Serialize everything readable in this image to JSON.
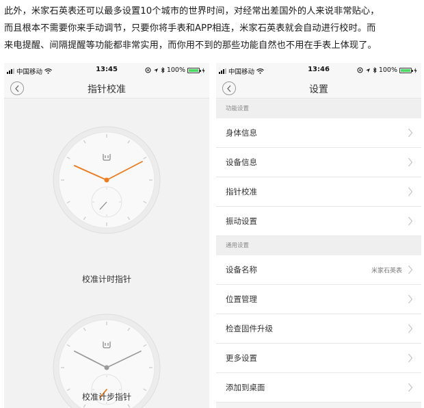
{
  "article": {
    "lines": [
      "此外，米家石英表还可以最多设置10个城市的世界时间，对经常出差国外的人来说非常贴心，",
      "而且根本不需要你来手动调节，只要你将手表和APP相连，米家石英表就会自动进行校时。而",
      "来电提醒、间隔提醒等功能都非常实用，而你用不到的那些功能自然也不用在手表上体现了。"
    ]
  },
  "left_screen": {
    "status": {
      "carrier": "中国移动",
      "time": "13:45",
      "battery": "100%"
    },
    "title": "指针校准",
    "dials": [
      {
        "label": "校准计时指针"
      },
      {
        "label": "校准计步指针"
      }
    ]
  },
  "right_screen": {
    "status": {
      "carrier": "中国移动",
      "time": "13:46",
      "battery": "100%"
    },
    "title": "设置",
    "sections": [
      {
        "header": "功能设置",
        "items": [
          {
            "label": "身体信息",
            "value": ""
          },
          {
            "label": "设备信息",
            "value": ""
          },
          {
            "label": "指针校准",
            "value": ""
          },
          {
            "label": "振动设置",
            "value": ""
          }
        ]
      },
      {
        "header": "通用设置",
        "items": [
          {
            "label": "设备名称",
            "value": "米家石英表"
          },
          {
            "label": "位置管理",
            "value": ""
          },
          {
            "label": "检查固件升级",
            "value": ""
          },
          {
            "label": "更多设置",
            "value": ""
          },
          {
            "label": "添加到桌面",
            "value": ""
          }
        ]
      }
    ]
  },
  "colors": {
    "accent_orange": "#f07c1e",
    "hand_gray": "#9a9a9a",
    "battery_green": "#4cd964"
  },
  "icons": [
    "back-chevron-icon",
    "chevron-right-icon",
    "signal-icon",
    "wifi-icon",
    "location-icon",
    "bluetooth-icon",
    "battery-icon",
    "charging-icon",
    "mi-logo-icon"
  ]
}
